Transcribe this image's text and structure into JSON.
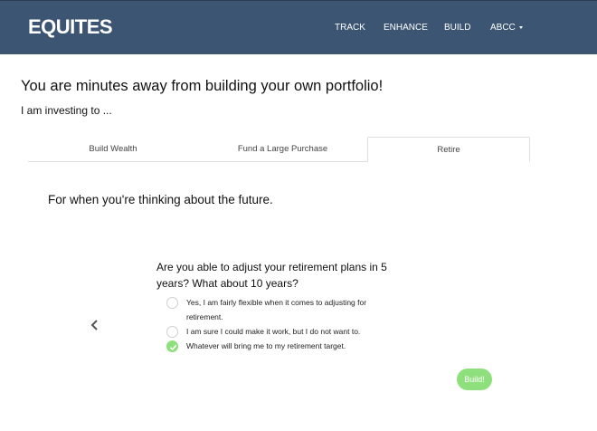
{
  "navbar": {
    "brand": "EQUITES",
    "links": [
      "TRACK",
      "ENHANCE",
      "BUILD"
    ],
    "account": "ABCC"
  },
  "page": {
    "headline": "You are minutes away from building your own portfolio!",
    "subline": "I am investing to ..."
  },
  "tabs": {
    "items": [
      "Build Wealth",
      "Fund a Large Purchase",
      "Retire"
    ],
    "active": "Retire"
  },
  "tab_description": "For when you're thinking about the future.",
  "question": {
    "text": "Are you able to adjust your retirement plans in 5 years? What about 10 years?",
    "options": [
      {
        "label": "Yes, I am fairly flexible when it comes to adjusting for retirement.",
        "selected": false
      },
      {
        "label": "I am sure I could make it work, but I do not want to.",
        "selected": false
      },
      {
        "label": "Whatever will bring me to my retirement target.",
        "selected": true
      }
    ]
  },
  "actions": {
    "build_label": "Build!"
  },
  "icons": {
    "prev": "chevron-left-icon",
    "caret": "caret-down-icon",
    "check": "check-icon"
  },
  "colors": {
    "navbar": "#3b5572",
    "accent": "#8ee07c"
  }
}
